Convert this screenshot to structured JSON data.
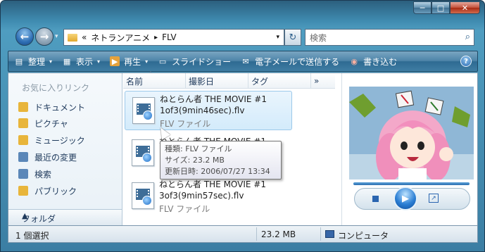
{
  "window": {
    "minimize_glyph": "─",
    "maximize_glyph": "□",
    "close_glyph": "✕"
  },
  "nav": {
    "back_glyph": "←",
    "forward_glyph": "→",
    "recent_glyph": "▾",
    "breadcrumb_prefix": "«",
    "breadcrumb": [
      "ネトランアニメ",
      "FLV"
    ],
    "separator": "▸",
    "dropdown_glyph": "▾",
    "refresh_glyph": "↻",
    "search_placeholder": "検索",
    "search_icon_glyph": "⌕"
  },
  "toolbar": {
    "items": [
      {
        "label": "整理",
        "icon": "organize-icon",
        "glyph": "▤",
        "has_arrow": true
      },
      {
        "label": "表示",
        "icon": "views-icon",
        "glyph": "▦",
        "has_arrow": true
      },
      {
        "label": "再生",
        "icon": "play-icon",
        "glyph": "▶",
        "has_arrow": true
      },
      {
        "label": "スライドショー",
        "icon": "slideshow-icon",
        "glyph": "▭",
        "has_arrow": false
      },
      {
        "label": "電子メールで送信する",
        "icon": "email-icon",
        "glyph": "✉",
        "has_arrow": false
      },
      {
        "label": "書き込む",
        "icon": "burn-icon",
        "glyph": "◉",
        "has_arrow": false
      }
    ],
    "arrow_glyph": "▾",
    "help_glyph": "?"
  },
  "sidebar": {
    "favorites_heading": "お気に入りリンク",
    "items": [
      {
        "label": "ドキュメント",
        "icon": "documents-icon",
        "color": "#e8b53b"
      },
      {
        "label": "ピクチャ",
        "icon": "pictures-icon",
        "color": "#e8b53b"
      },
      {
        "label": "ミュージック",
        "icon": "music-icon",
        "color": "#e8b53b"
      },
      {
        "label": "最近の変更",
        "icon": "recent-changes-icon",
        "color": "#5b87b8"
      },
      {
        "label": "検索",
        "icon": "search-folder-icon",
        "color": "#5b87b8"
      },
      {
        "label": "パブリック",
        "icon": "public-icon",
        "color": "#e8b53b"
      }
    ],
    "folders_label": "フォルダ",
    "folders_toggle_glyph": "▲"
  },
  "columns": {
    "name": "名前",
    "date_taken": "撮影日",
    "tags": "タグ",
    "more": "»",
    "sort_glyph": "^"
  },
  "files": [
    {
      "line1": "ねとらん者 THE MOVIE #1",
      "line2": "1of3(9min46sec).flv",
      "type": "FLV ファイル",
      "selected": true
    },
    {
      "line1": "ねとらん者 THE MOVIE #1",
      "line2": "",
      "type": "",
      "selected": false
    },
    {
      "line1": "ねとらん者 THE MOVIE #1",
      "line2": "3of3(9min57sec).flv",
      "type": "FLV ファイル",
      "selected": false
    }
  ],
  "tooltip": {
    "type": "種類: FLV ファイル",
    "size": "サイズ: 23.2 MB",
    "modified": "更新日時: 2006/07/27 13:34"
  },
  "preview": {
    "progress": 1.0,
    "play_glyph": "▶",
    "fullscreen_glyph": "↗"
  },
  "status": {
    "selection": "1 個選択",
    "size": "23.2 MB",
    "zone": "コンピュータ"
  },
  "colors": {
    "frame": "#3b7ea3",
    "toolbar": "#4d84a8",
    "selection": "#d3ebfb",
    "accent": "#2c7fd4"
  }
}
